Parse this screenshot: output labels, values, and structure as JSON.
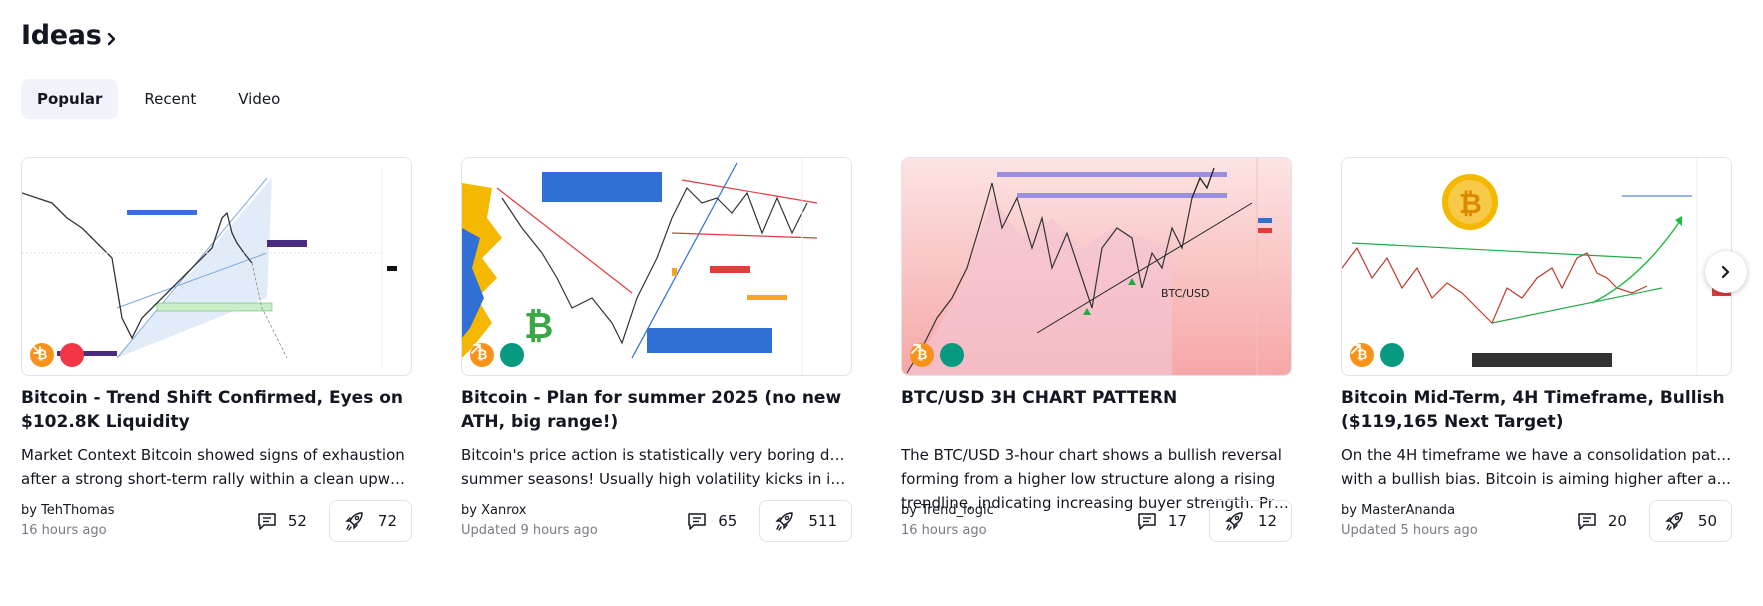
{
  "header": {
    "title": "Ideas"
  },
  "tabs": [
    {
      "label": "Popular",
      "active": true
    },
    {
      "label": "Recent",
      "active": false
    },
    {
      "label": "Video",
      "active": false
    }
  ],
  "cards": [
    {
      "title": "Bitcoin - Trend Shift Confirmed, Eyes on $102.8K Liquidity",
      "desc_lines": [
        "Market Context Bitcoin showed signs of exhaustion",
        "after a strong short-term rally within a clean upwar..."
      ],
      "author": "by TehThomas",
      "time": "16 hours ago",
      "comments": "52",
      "boosts": "72",
      "direction": "short"
    },
    {
      "title": "Bitcoin - Plan for summer 2025 (no new ATH, big range!)",
      "desc_lines": [
        "Bitcoin's price action is statistically very boring during",
        "summer seasons! Usually high volatility kicks in in..."
      ],
      "author": "by Xanrox",
      "time": "Updated 9 hours ago",
      "comments": "65",
      "boosts": "511",
      "direction": "long"
    },
    {
      "title": "BTC/USD 3H CHART PATTERN",
      "desc_lines": [
        "The BTC/USD 3-hour chart shows a bullish reversal",
        "forming from a higher low structure along a rising",
        "trendline, indicating increasing buyer strength. Pric..."
      ],
      "author": "by Trend_logic",
      "time": "16 hours ago",
      "comments": "17",
      "boosts": "12",
      "direction": "long",
      "chart_label": "BTC/USD"
    },
    {
      "title": "Bitcoin Mid-Term, 4H Timeframe, Bullish ($119,165 Next Target)",
      "desc_lines": [
        "On the 4H timeframe we have a consolidation pattern",
        "with a bullish bias. Bitcoin is aiming higher after a..."
      ],
      "author": "by MasterAnanda",
      "time": "Updated 5 hours ago",
      "comments": "20",
      "boosts": "50",
      "direction": "long"
    }
  ],
  "colors": {
    "brand_btc": "#f7931a",
    "short": "#f23645",
    "long": "#089981",
    "text": "#131722",
    "muted": "#787b86",
    "border": "#e0e3eb"
  },
  "icons": {
    "btc_badge": "bitcoin-icon",
    "short_badge": "arrow-down-right-icon",
    "long_badge": "arrow-up-right-icon",
    "comments": "comment-icon",
    "boost": "rocket-icon",
    "next": "chevron-right-icon"
  }
}
